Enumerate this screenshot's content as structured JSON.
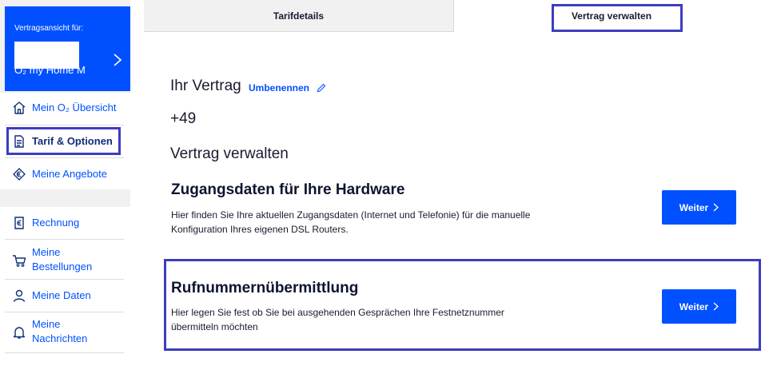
{
  "sidebar": {
    "contract_card": {
      "label": "Vertragsansicht für:",
      "contract_name": "O₂ my Home M"
    },
    "nav_group_1": [
      {
        "label": "Mein O₂ Übersicht",
        "icon": "home-icon"
      },
      {
        "label": "Tarif & Optionen",
        "icon": "document-icon",
        "active": true
      },
      {
        "label": "Meine Angebote",
        "icon": "euro-tag-icon"
      }
    ],
    "nav_group_2": [
      {
        "label": "Rechnung",
        "icon": "invoice-euro-icon"
      },
      {
        "label": "Meine Bestellungen",
        "line1": "Meine",
        "line2": "Bestellungen",
        "icon": "cart-icon"
      },
      {
        "label": "Meine Daten",
        "icon": "person-icon"
      },
      {
        "label": "Meine Nachrichten",
        "line1": "Meine",
        "line2": "Nachrichten",
        "icon": "bell-icon"
      }
    ]
  },
  "tabs": [
    {
      "label": "Tarifdetails",
      "active": false
    },
    {
      "label": "Vertrag verwalten",
      "active": true
    }
  ],
  "main": {
    "contract_title": "Ihr Vertrag",
    "rename_link": "Umbenennen",
    "phone_number": "+49",
    "manage_title": "Vertrag verwalten",
    "sections": [
      {
        "title": "Zugangsdaten für Ihre Hardware",
        "description": "Hier finden Sie Ihre aktuellen Zugangsdaten (Internet und Telefonie) für die manuelle Konfiguration Ihres eigenen DSL Routers.",
        "button": "Weiter"
      },
      {
        "title": "Rufnummernübermittlung",
        "description": "Hier legen Sie fest ob Sie bei ausgehenden Gesprächen Ihre Festnetznummer übermitteln möchten",
        "button": "Weiter"
      }
    ]
  },
  "colors": {
    "brand_blue": "#0050ff",
    "highlight": "#3d3dbf",
    "sidebar_bg": "#f1f1f1"
  }
}
